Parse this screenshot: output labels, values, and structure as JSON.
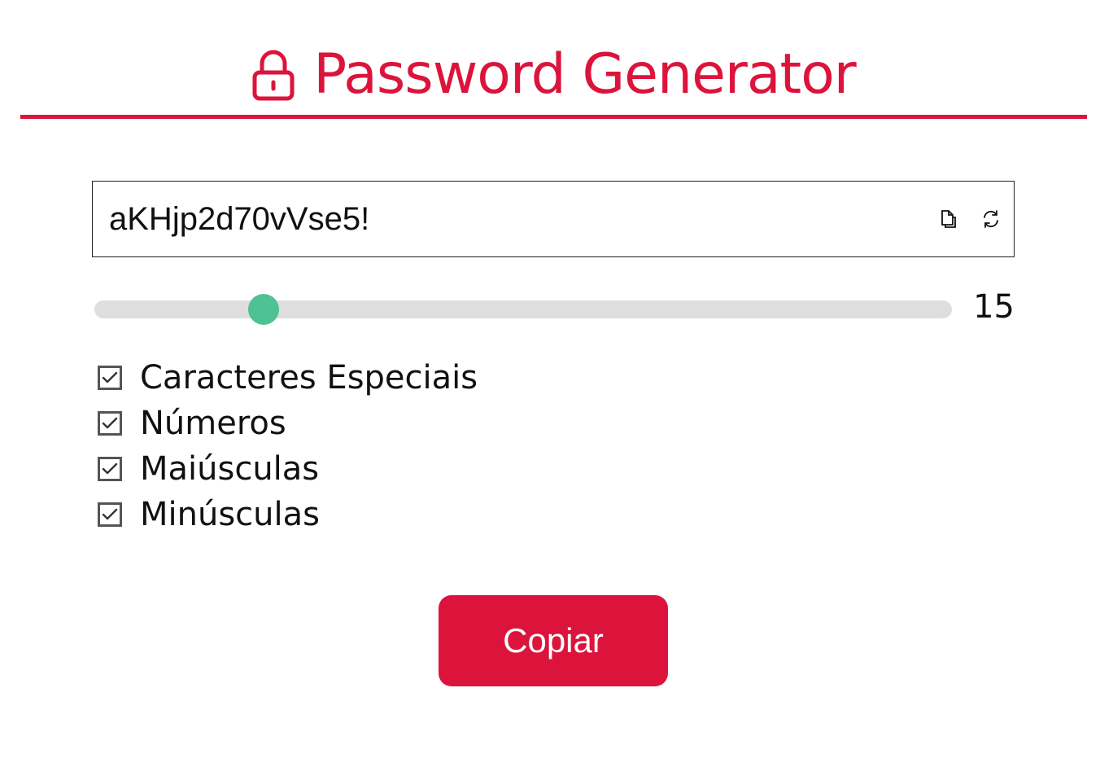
{
  "header": {
    "title": "Password Generator",
    "icon": "lock-icon",
    "accent_color": "#dc143c"
  },
  "password": {
    "value": "aKHjp2d70vVse5!",
    "copy_icon": "copy-icon",
    "refresh_icon": "refresh-icon"
  },
  "length_slider": {
    "value": "15",
    "min": 4,
    "max": 64,
    "thumb_color": "#4ec292"
  },
  "options": [
    {
      "label": "Caracteres Especiais",
      "checked": true
    },
    {
      "label": "Números",
      "checked": true
    },
    {
      "label": "Maiúsculas",
      "checked": true
    },
    {
      "label": "Minúsculas",
      "checked": true
    }
  ],
  "actions": {
    "copy_label": "Copiar",
    "button_color": "#dc143c"
  }
}
